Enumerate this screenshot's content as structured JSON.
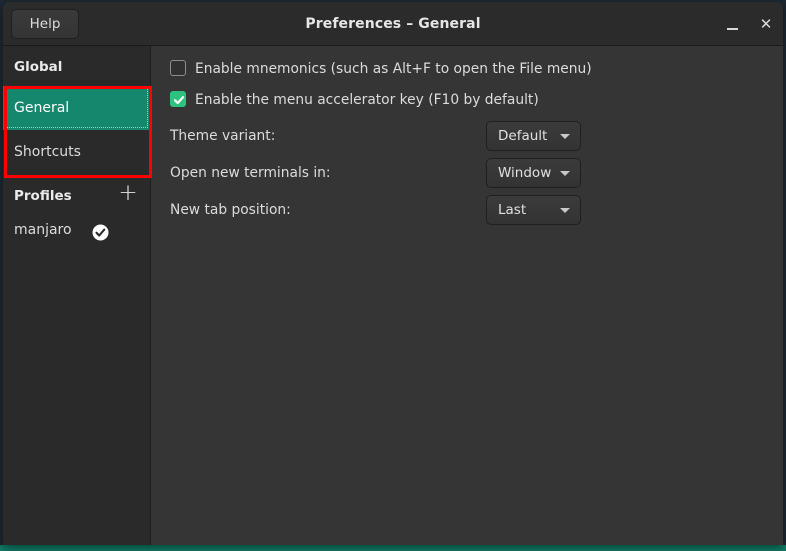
{
  "window": {
    "title": "Preferences – General",
    "help_label": "Help",
    "minimize_label": "_",
    "close_label": "✕"
  },
  "sidebar": {
    "global_header": "Global",
    "items": [
      {
        "label": "General",
        "selected": true
      },
      {
        "label": "Shortcuts",
        "selected": false
      }
    ],
    "profiles_header": "Profiles",
    "add_profile_label": "+",
    "profiles": [
      {
        "label": "manjaro",
        "is_default": true
      }
    ]
  },
  "content": {
    "checkboxes": [
      {
        "label": "Enable mnemonics (such as Alt+F to open the File menu)",
        "checked": false
      },
      {
        "label": "Enable the menu accelerator key (F10 by default)",
        "checked": true
      }
    ],
    "selects": [
      {
        "label": "Theme variant:",
        "value": "Default"
      },
      {
        "label": "Open new terminals in:",
        "value": "Window"
      },
      {
        "label": "New tab position:",
        "value": "Last"
      }
    ]
  },
  "colors": {
    "accent_teal": "#14876c",
    "check_green": "#2ec27e",
    "annotation_red": "#ff0000",
    "desktop": "#0f7d66",
    "window_bg": "#353535",
    "sidebar_bg": "#2a2a2a",
    "header_bg": "#2b2b2b"
  }
}
